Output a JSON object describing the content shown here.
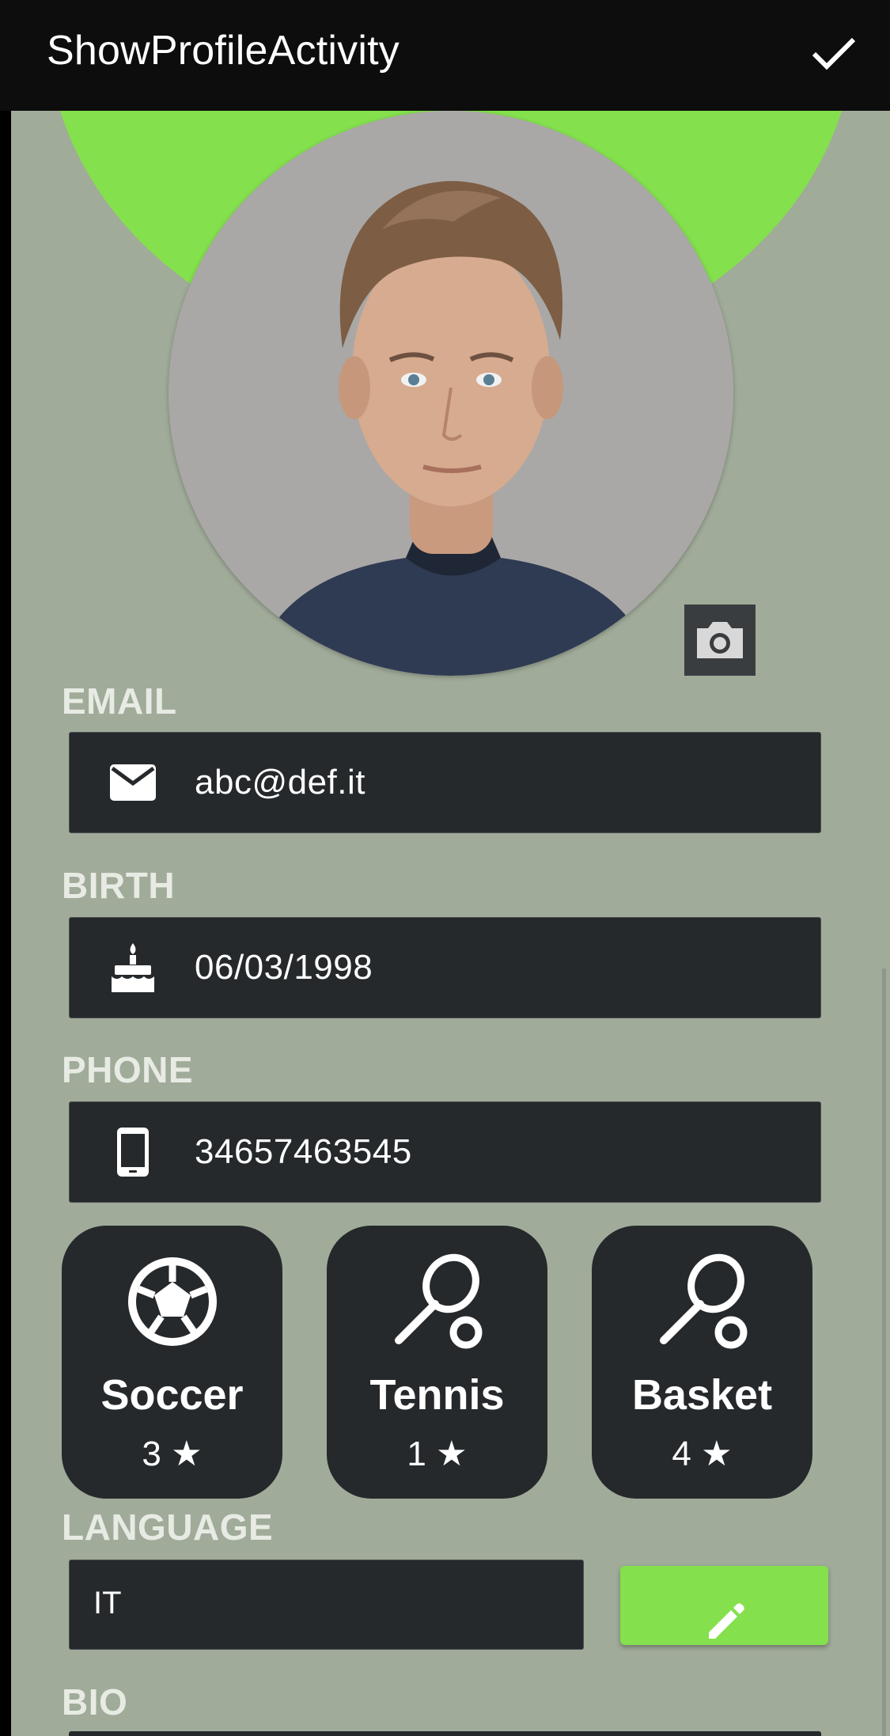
{
  "app_bar": {
    "title": "ShowProfileActivity",
    "confirm_icon": "check-icon"
  },
  "profile": {
    "avatar_icon": "profile-photo",
    "camera_icon": "camera-icon"
  },
  "fields": {
    "email": {
      "label": "EMAIL",
      "value": "abc@def.it",
      "icon": "mail-icon"
    },
    "birth": {
      "label": "BIRTH",
      "value": "06/03/1998",
      "icon": "cake-icon"
    },
    "phone": {
      "label": "PHONE",
      "value": "34657463545",
      "icon": "smartphone-icon"
    }
  },
  "sports": [
    {
      "name": "Soccer",
      "level": "3 ★",
      "icon": "soccer-ball-icon"
    },
    {
      "name": "Tennis",
      "level": "1 ★",
      "icon": "tennis-racket-icon"
    },
    {
      "name": "Basket",
      "level": "4 ★",
      "icon": "tennis-racket-icon"
    }
  ],
  "language": {
    "label": "LANGUAGE",
    "value": "IT",
    "edit_icon": "pencil-icon"
  },
  "bio": {
    "label": "BIO"
  },
  "colors": {
    "accent_green": "#84e04d",
    "background": "#a0ab99",
    "card_dark": "#25292c",
    "app_bar": "#0d0d0d"
  }
}
